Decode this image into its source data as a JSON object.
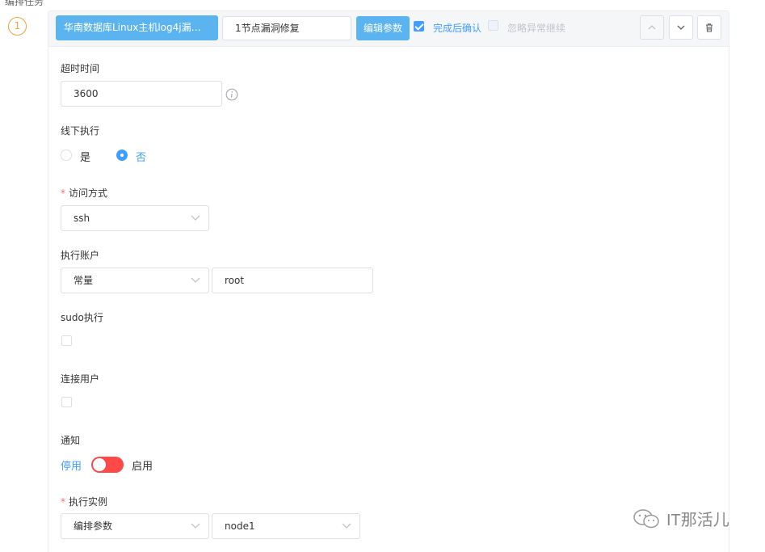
{
  "section": {
    "cut_title": "编排任务"
  },
  "step": {
    "number": "1"
  },
  "header": {
    "task_name": "华南数据库Linux主机log4j漏洞...",
    "task_desc_value": "1节点漏洞修复",
    "edit_params_label": "编辑参数",
    "confirm_after_done": {
      "label": "完成后确认",
      "checked": true
    },
    "ignore_exception": {
      "label": "忽略异常继续",
      "checked": false,
      "disabled": true
    },
    "icons": [
      "chevron-up-icon",
      "chevron-down-icon",
      "trash-icon"
    ]
  },
  "form": {
    "timeout": {
      "label": "超时时间",
      "value": "3600"
    },
    "offline": {
      "label": "线下执行",
      "options": [
        "是",
        "否"
      ],
      "selected": "否"
    },
    "access": {
      "label": "访问方式",
      "required": true,
      "value": "ssh"
    },
    "account": {
      "label": "执行账户",
      "type_value": "常量",
      "value": "root"
    },
    "sudo": {
      "label": "sudo执行",
      "checked": false
    },
    "connect_user": {
      "label": "连接用户",
      "checked": false
    },
    "notify": {
      "label": "通知",
      "off_label": "停用",
      "on_label": "启用",
      "enabled": false
    },
    "instance": {
      "label": "执行实例",
      "required": true,
      "source_value": "编排参数",
      "node_value": "node1"
    }
  },
  "watermark": {
    "text": "IT那活儿"
  },
  "colors": {
    "primary": "#409eff",
    "button_blue": "#5bb4ef",
    "step_orange": "#f0a040",
    "switch_red": "#ff4949"
  }
}
